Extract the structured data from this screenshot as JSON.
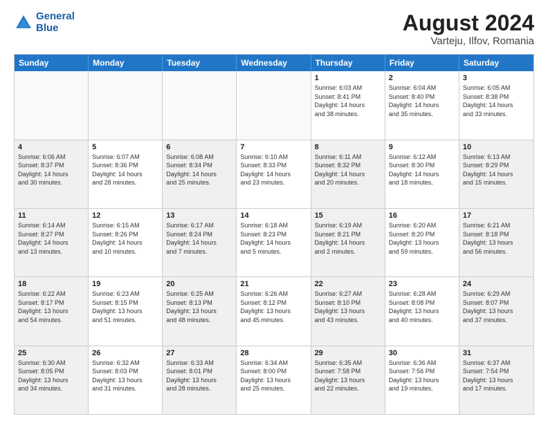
{
  "header": {
    "logo_line1": "General",
    "logo_line2": "Blue",
    "title": "August 2024",
    "subtitle": "Varteju, Ilfov, Romania"
  },
  "calendar": {
    "days_of_week": [
      "Sunday",
      "Monday",
      "Tuesday",
      "Wednesday",
      "Thursday",
      "Friday",
      "Saturday"
    ],
    "rows": [
      [
        {
          "day": "",
          "info": "",
          "empty": true
        },
        {
          "day": "",
          "info": "",
          "empty": true
        },
        {
          "day": "",
          "info": "",
          "empty": true
        },
        {
          "day": "",
          "info": "",
          "empty": true
        },
        {
          "day": "1",
          "info": "Sunrise: 6:03 AM\nSunset: 8:41 PM\nDaylight: 14 hours\nand 38 minutes."
        },
        {
          "day": "2",
          "info": "Sunrise: 6:04 AM\nSunset: 8:40 PM\nDaylight: 14 hours\nand 35 minutes."
        },
        {
          "day": "3",
          "info": "Sunrise: 6:05 AM\nSunset: 8:38 PM\nDaylight: 14 hours\nand 33 minutes."
        }
      ],
      [
        {
          "day": "4",
          "info": "Sunrise: 6:06 AM\nSunset: 8:37 PM\nDaylight: 14 hours\nand 30 minutes.",
          "shaded": true
        },
        {
          "day": "5",
          "info": "Sunrise: 6:07 AM\nSunset: 8:36 PM\nDaylight: 14 hours\nand 28 minutes."
        },
        {
          "day": "6",
          "info": "Sunrise: 6:08 AM\nSunset: 8:34 PM\nDaylight: 14 hours\nand 25 minutes.",
          "shaded": true
        },
        {
          "day": "7",
          "info": "Sunrise: 6:10 AM\nSunset: 8:33 PM\nDaylight: 14 hours\nand 23 minutes."
        },
        {
          "day": "8",
          "info": "Sunrise: 6:11 AM\nSunset: 8:32 PM\nDaylight: 14 hours\nand 20 minutes.",
          "shaded": true
        },
        {
          "day": "9",
          "info": "Sunrise: 6:12 AM\nSunset: 8:30 PM\nDaylight: 14 hours\nand 18 minutes."
        },
        {
          "day": "10",
          "info": "Sunrise: 6:13 AM\nSunset: 8:29 PM\nDaylight: 14 hours\nand 15 minutes.",
          "shaded": true
        }
      ],
      [
        {
          "day": "11",
          "info": "Sunrise: 6:14 AM\nSunset: 8:27 PM\nDaylight: 14 hours\nand 13 minutes.",
          "shaded": true
        },
        {
          "day": "12",
          "info": "Sunrise: 6:15 AM\nSunset: 8:26 PM\nDaylight: 14 hours\nand 10 minutes."
        },
        {
          "day": "13",
          "info": "Sunrise: 6:17 AM\nSunset: 8:24 PM\nDaylight: 14 hours\nand 7 minutes.",
          "shaded": true
        },
        {
          "day": "14",
          "info": "Sunrise: 6:18 AM\nSunset: 8:23 PM\nDaylight: 14 hours\nand 5 minutes."
        },
        {
          "day": "15",
          "info": "Sunrise: 6:19 AM\nSunset: 8:21 PM\nDaylight: 14 hours\nand 2 minutes.",
          "shaded": true
        },
        {
          "day": "16",
          "info": "Sunrise: 6:20 AM\nSunset: 8:20 PM\nDaylight: 13 hours\nand 59 minutes."
        },
        {
          "day": "17",
          "info": "Sunrise: 6:21 AM\nSunset: 8:18 PM\nDaylight: 13 hours\nand 56 minutes.",
          "shaded": true
        }
      ],
      [
        {
          "day": "18",
          "info": "Sunrise: 6:22 AM\nSunset: 8:17 PM\nDaylight: 13 hours\nand 54 minutes.",
          "shaded": true
        },
        {
          "day": "19",
          "info": "Sunrise: 6:23 AM\nSunset: 8:15 PM\nDaylight: 13 hours\nand 51 minutes."
        },
        {
          "day": "20",
          "info": "Sunrise: 6:25 AM\nSunset: 8:13 PM\nDaylight: 13 hours\nand 48 minutes.",
          "shaded": true
        },
        {
          "day": "21",
          "info": "Sunrise: 6:26 AM\nSunset: 8:12 PM\nDaylight: 13 hours\nand 45 minutes."
        },
        {
          "day": "22",
          "info": "Sunrise: 6:27 AM\nSunset: 8:10 PM\nDaylight: 13 hours\nand 43 minutes.",
          "shaded": true
        },
        {
          "day": "23",
          "info": "Sunrise: 6:28 AM\nSunset: 8:08 PM\nDaylight: 13 hours\nand 40 minutes."
        },
        {
          "day": "24",
          "info": "Sunrise: 6:29 AM\nSunset: 8:07 PM\nDaylight: 13 hours\nand 37 minutes.",
          "shaded": true
        }
      ],
      [
        {
          "day": "25",
          "info": "Sunrise: 6:30 AM\nSunset: 8:05 PM\nDaylight: 13 hours\nand 34 minutes.",
          "shaded": true
        },
        {
          "day": "26",
          "info": "Sunrise: 6:32 AM\nSunset: 8:03 PM\nDaylight: 13 hours\nand 31 minutes."
        },
        {
          "day": "27",
          "info": "Sunrise: 6:33 AM\nSunset: 8:01 PM\nDaylight: 13 hours\nand 28 minutes.",
          "shaded": true
        },
        {
          "day": "28",
          "info": "Sunrise: 6:34 AM\nSunset: 8:00 PM\nDaylight: 13 hours\nand 25 minutes."
        },
        {
          "day": "29",
          "info": "Sunrise: 6:35 AM\nSunset: 7:58 PM\nDaylight: 13 hours\nand 22 minutes.",
          "shaded": true
        },
        {
          "day": "30",
          "info": "Sunrise: 6:36 AM\nSunset: 7:56 PM\nDaylight: 13 hours\nand 19 minutes."
        },
        {
          "day": "31",
          "info": "Sunrise: 6:37 AM\nSunset: 7:54 PM\nDaylight: 13 hours\nand 17 minutes.",
          "shaded": true
        }
      ]
    ]
  }
}
